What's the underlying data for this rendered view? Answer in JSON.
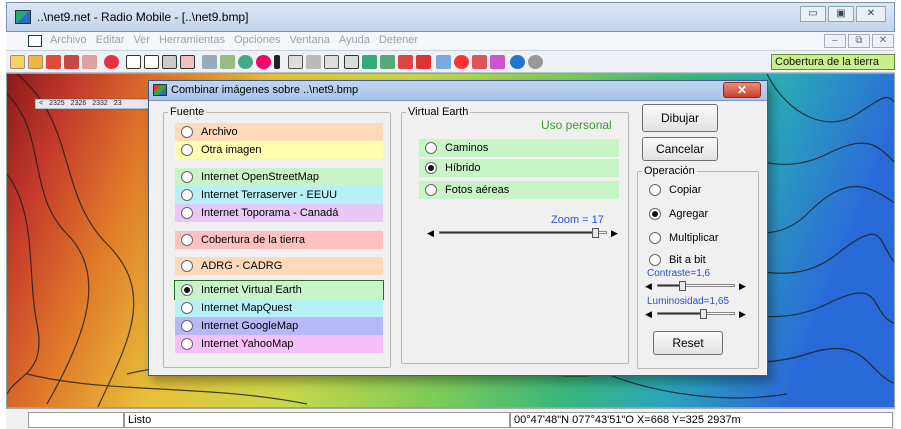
{
  "window": {
    "title": "..\\net9.net - Radio Mobile - [..\\net9.bmp]",
    "ctl_min": "▭",
    "ctl_max": "▣",
    "ctl_close": "✕"
  },
  "menubar": {
    "items": [
      "Archivo",
      "Editar",
      "Ver",
      "Herramientas",
      "Opciones",
      "Ventana",
      "Ayuda",
      "Detener"
    ],
    "mdi_min": "–",
    "mdi_restore": "⧉",
    "mdi_close": "✕"
  },
  "toolbar": {
    "coverage_label": "Cobertura de la tierra"
  },
  "map": {
    "ruler_labels": [
      "<",
      "2325",
      "2326",
      "2332",
      "23"
    ]
  },
  "status": {
    "left": "",
    "state": "Listo",
    "coords": "00°47'48\"N 077°43'51\"O  X=668 Y=325 2937m"
  },
  "dialog": {
    "title": "Combinar imágenes sobre ..\\net9.bmp",
    "close": "✕",
    "fuente": {
      "legend": "Fuente",
      "options": [
        {
          "label": "Archivo",
          "color": "#ffd9b8",
          "selected": false
        },
        {
          "label": "Otra imagen",
          "color": "#ffffb0",
          "selected": false
        },
        {
          "label": "Internet OpenStreetMap",
          "color": "#c8f5c8",
          "selected": false
        },
        {
          "label": "Internet Terraserver - EEUU",
          "color": "#b8f0f8",
          "selected": false
        },
        {
          "label": "Internet Toporama - Canadá",
          "color": "#e8c8f8",
          "selected": false
        },
        {
          "label": "Cobertura de la tierra",
          "color": "#ffc0c0",
          "selected": false
        },
        {
          "label": "ADRG - CADRG",
          "color": "#ffd9b8",
          "selected": false
        },
        {
          "label": "Internet Virtual Earth",
          "color": "#c8f5c8",
          "selected": true
        },
        {
          "label": "Internet MapQuest",
          "color": "#b8f0f8",
          "selected": false
        },
        {
          "label": "Internet GoogleMap",
          "color": "#b8b8f8",
          "selected": false
        },
        {
          "label": "Internet YahooMap",
          "color": "#f8c0f8",
          "selected": false
        }
      ]
    },
    "virtual_earth": {
      "legend": "Virtual Earth",
      "license": "Uso personal",
      "options": [
        {
          "label": "Caminos",
          "selected": false
        },
        {
          "label": "Híbrido",
          "selected": true
        },
        {
          "label": "Fotos aéreas",
          "selected": false
        }
      ],
      "zoom_label": "Zoom = 17",
      "zoom_value": 0.95
    },
    "buttons": {
      "draw": "Dibujar",
      "cancel": "Cancelar",
      "reset": "Reset"
    },
    "operacion": {
      "legend": "Operación",
      "options": [
        {
          "label": "Copiar",
          "selected": false
        },
        {
          "label": "Agregar",
          "selected": true
        },
        {
          "label": "Multiplicar",
          "selected": false
        },
        {
          "label": "Bit a bit",
          "selected": false
        }
      ],
      "contrast_label": "Contraste=1,6",
      "contrast_value": 0.3,
      "brightness_label": "Luminosidad=1,65",
      "brightness_value": 0.6
    }
  },
  "colors": {
    "accent_blue": "#2a4fd6",
    "coverage_green": "#c8f08c",
    "close_red": "#c8402a"
  }
}
